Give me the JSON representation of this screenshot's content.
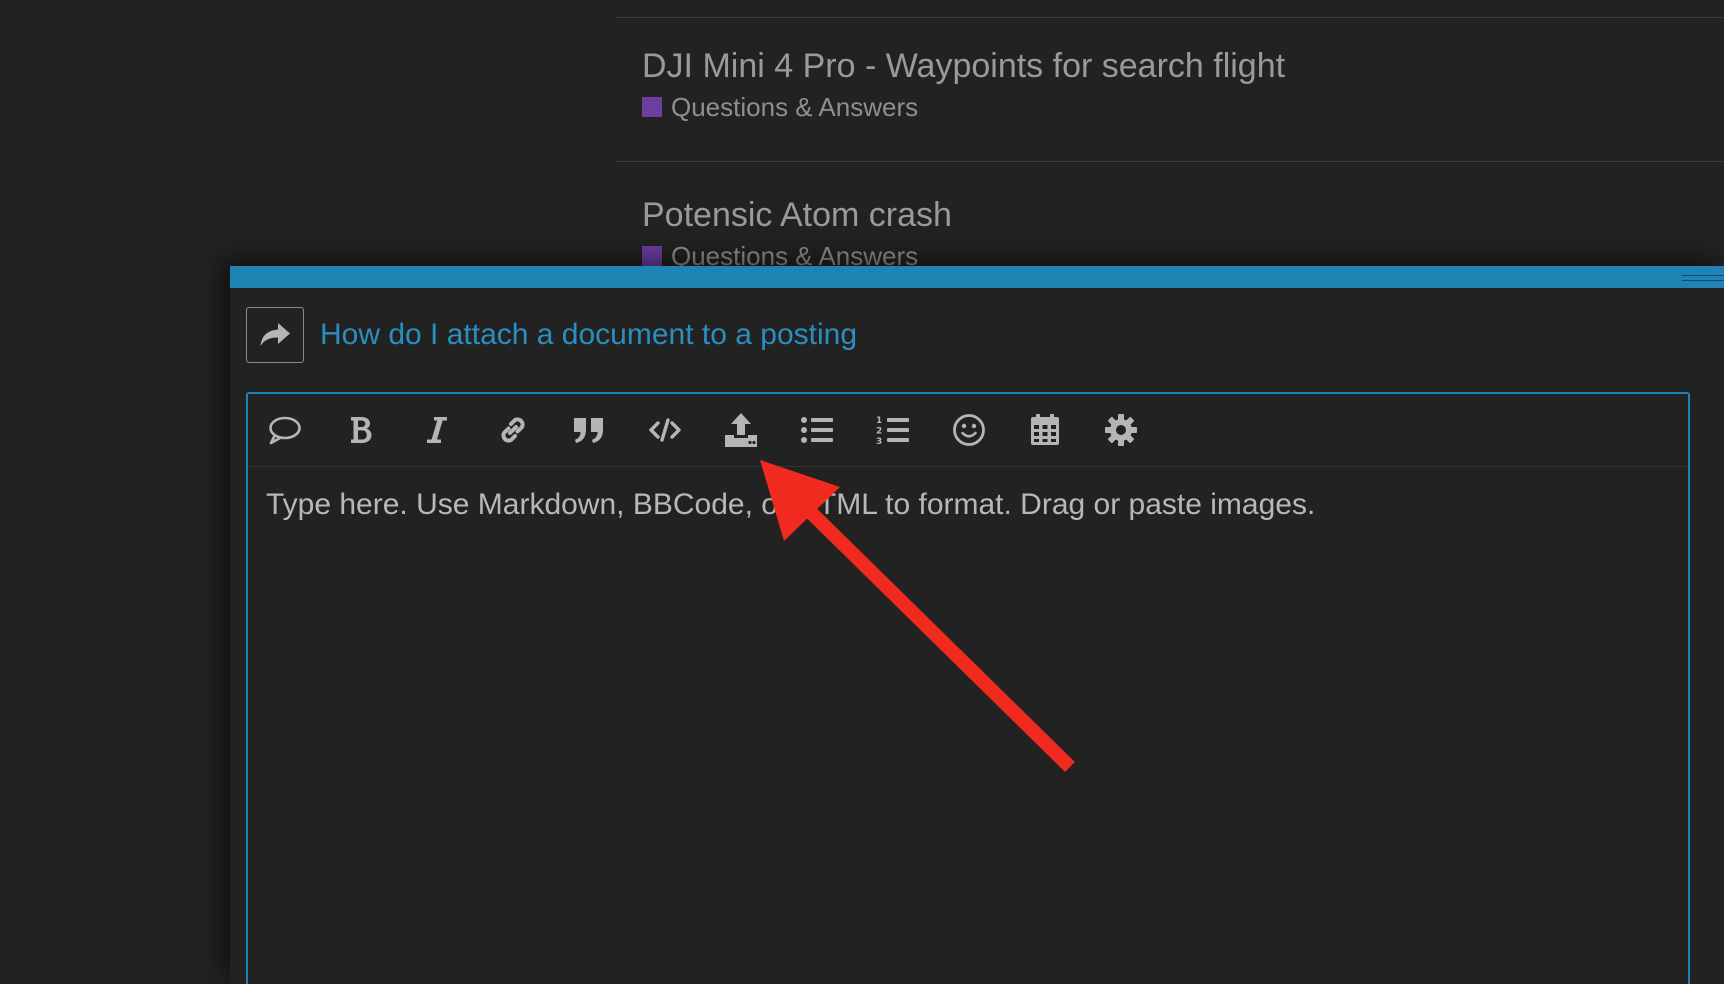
{
  "topics": [
    {
      "title": "DJI Mini 4 Pro - Waypoints for search flight",
      "category": "Questions & Answers",
      "category_color": "#6b3fa0"
    },
    {
      "title": "Potensic Atom crash",
      "category": "Questions & Answers",
      "category_color": "#6b3fa0"
    }
  ],
  "composer": {
    "accent_color": "#1f84b3",
    "reply_icon": "share-arrow-icon",
    "reply_title": "How do I attach a document to a posting",
    "toolbar": [
      {
        "name": "quote-post-icon",
        "label": "Quote post"
      },
      {
        "name": "bold-icon",
        "label": "Bold"
      },
      {
        "name": "italic-icon",
        "label": "Italic"
      },
      {
        "name": "link-icon",
        "label": "Hyperlink"
      },
      {
        "name": "blockquote-icon",
        "label": "Blockquote"
      },
      {
        "name": "code-icon",
        "label": "Preformatted text"
      },
      {
        "name": "upload-icon",
        "label": "Upload"
      },
      {
        "name": "bulleted-list-icon",
        "label": "Bulleted list"
      },
      {
        "name": "numbered-list-icon",
        "label": "Numbered list"
      },
      {
        "name": "emoji-icon",
        "label": "Insert emoji"
      },
      {
        "name": "calendar-icon",
        "label": "Insert date"
      },
      {
        "name": "gear-icon",
        "label": "Options"
      }
    ],
    "editor_placeholder": "Type here. Use Markdown, BBCode, or HTML to format. Drag or paste images."
  },
  "annotation": {
    "color": "#f02a1f",
    "points_to": "upload-icon"
  }
}
